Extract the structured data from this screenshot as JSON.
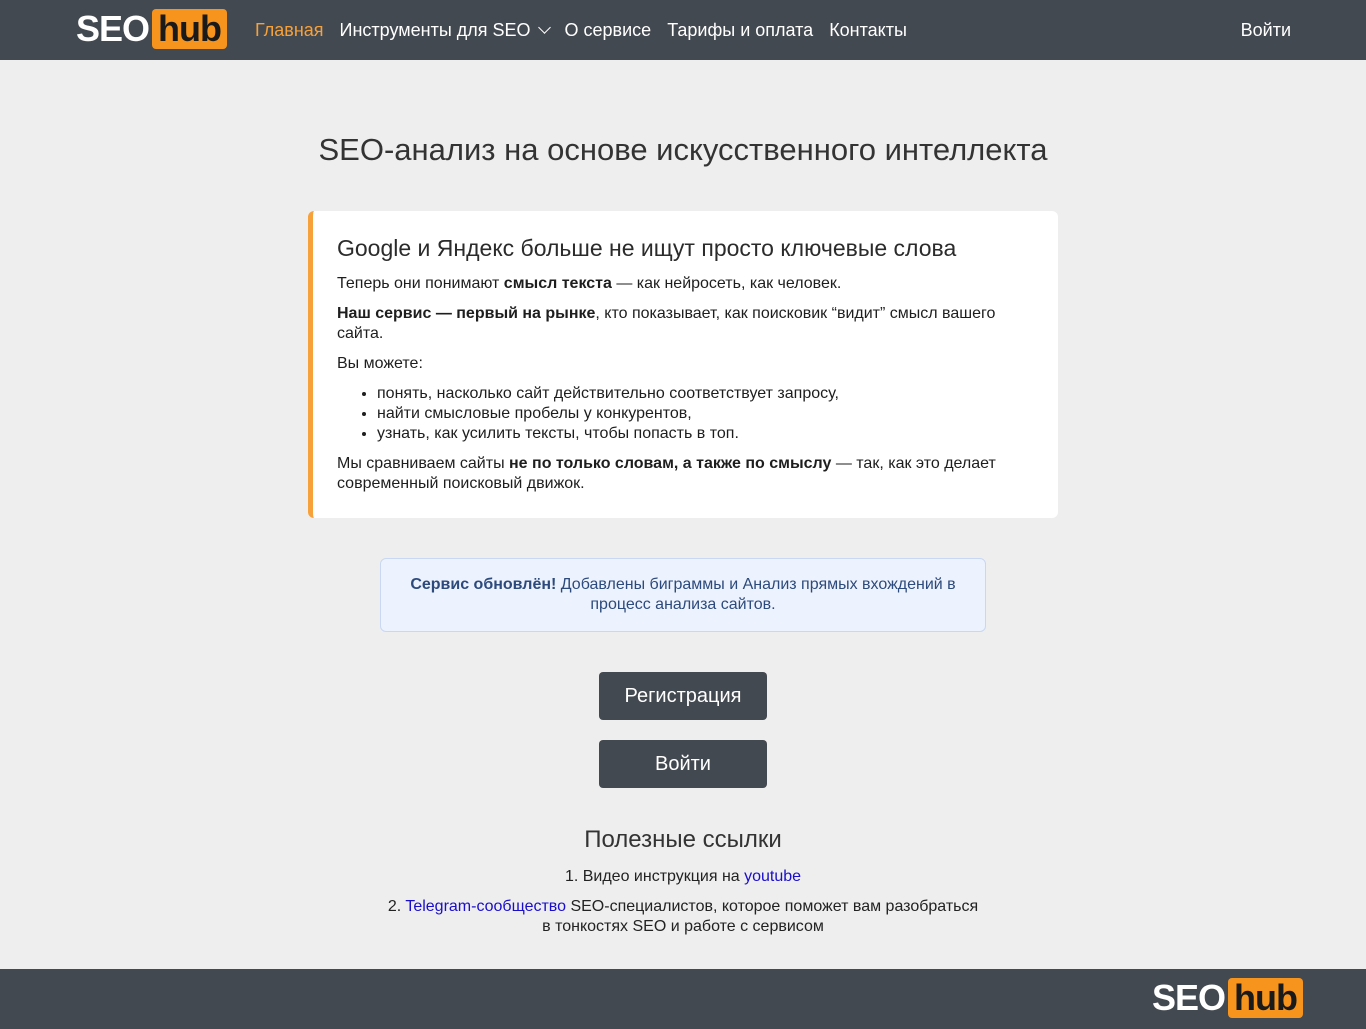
{
  "header": {
    "logo": {
      "seo": "SEO",
      "hub": "hub"
    },
    "nav": [
      {
        "label": "Главная",
        "active": true
      },
      {
        "label": "Инструменты для SEO",
        "dropdown": true
      },
      {
        "label": "О сервисе"
      },
      {
        "label": "Тарифы и оплата"
      },
      {
        "label": "Контакты"
      }
    ],
    "login": "Войти"
  },
  "main": {
    "title": "SEO-анализ на основе искусственного интеллекта",
    "card": {
      "heading": "Google и Яндекс больше не ищут просто ключевые слова",
      "p1_pre": "Теперь они понимают ",
      "p1_bold": "смысл текста",
      "p1_post": " — как нейросеть, как человек.",
      "p2_bold": "Наш сервис — первый на рынке",
      "p2_post": ", кто показывает, как поисковик “видит” смысл вашего сайта.",
      "p3": "Вы можете:",
      "items": [
        "понять, насколько сайт действительно соответствует запросу,",
        "найти смысловые пробелы у конкурентов,",
        "узнать, как усилить тексты, чтобы попасть в топ."
      ],
      "p4_pre": "Мы сравниваем сайты ",
      "p4_bold": "не по только словам, а также по смыслу",
      "p4_post": " — так, как это делает современный поисковый движок."
    },
    "notice": {
      "bold": "Сервис обновлён!",
      "text": " Добавлены биграммы и Анализ прямых вхождений в процесс анализа сайтов."
    },
    "buttons": {
      "register": "Регистрация",
      "login": "Войти"
    },
    "links": {
      "title": "Полезные ссылки",
      "item1_pre": "1. Видео инструкция на ",
      "item1_link": "youtube",
      "item2_pre": "2. ",
      "item2_link": "Telegram-сообщество",
      "item2_post": " SEO-специалистов, которое поможет вам разобраться в тонкостях SEO и работе с сервисом"
    }
  },
  "footer": {
    "logo": {
      "seo": "SEO",
      "hub": "hub"
    }
  },
  "colors": {
    "nav_bg": "#434950",
    "accent": "#f7a13a",
    "page_bg": "#eeeeee",
    "link": "#1a0dcc"
  }
}
